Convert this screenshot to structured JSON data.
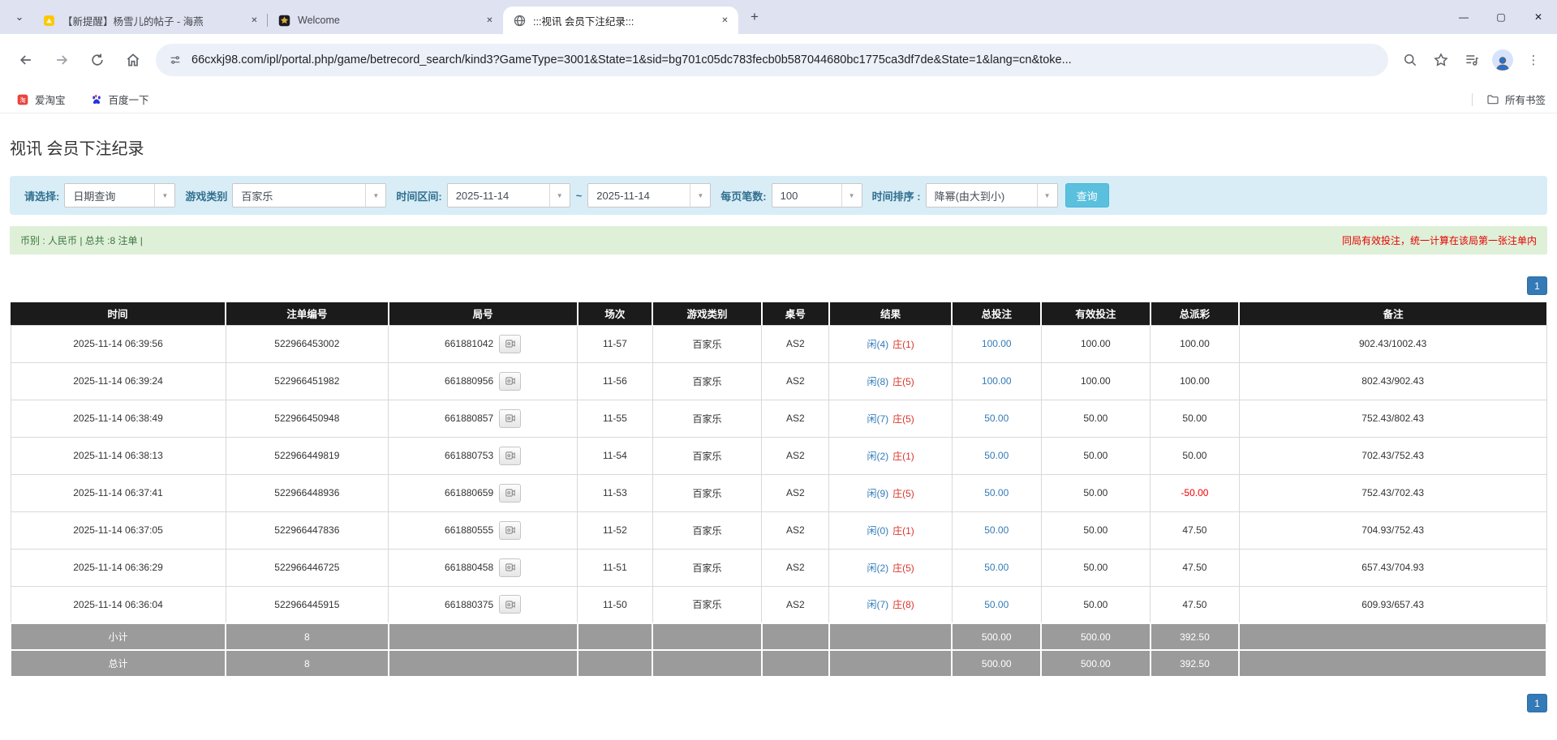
{
  "icons": {
    "tab_search": "⌄",
    "new_tab": "+",
    "minimize": "—",
    "maximize": "▢",
    "close": "✕",
    "tab_close": "✕",
    "dropdown": "▼",
    "more_vert": "⋮"
  },
  "browser": {
    "tabs": [
      {
        "title": "【新提醒】杨雪儿的帖子 - 海燕",
        "icon": "yellow-mail-icon",
        "active": false
      },
      {
        "title": "Welcome",
        "icon": "dark-emblem-icon",
        "active": false
      },
      {
        "title": ":::视讯 会员下注纪录:::",
        "icon": "globe-icon",
        "active": true
      }
    ],
    "url": "66cxkj98.com/ipl/portal.php/game/betrecord_search/kind3?GameType=3001&State=1&sid=bg701c05dc783fecb0b587044680bc1775ca3df7de&State=1&lang=cn&toke...",
    "bookmarks": [
      {
        "label": "爱淘宝",
        "icon": "taobao-icon"
      },
      {
        "label": "百度一下",
        "icon": "baidu-icon"
      }
    ],
    "bookmarks_right": {
      "label": "所有书签",
      "icon": "folder-icon"
    }
  },
  "page": {
    "title": "视讯 会员下注纪录",
    "filters": {
      "select_label": "请选择:",
      "select_value": "日期查询",
      "game_type_label": "游戏类别",
      "game_type_value": "百家乐",
      "date_range_label": "时间区间:",
      "date_from": "2025-11-14",
      "date_separator": "~",
      "date_to": "2025-11-14",
      "page_size_label": "每页笔数:",
      "page_size_value": "100",
      "sort_label": "时间排序 :",
      "sort_value": "降幂(由大到小)",
      "search_button": "查询"
    },
    "info_bar": {
      "left": "币别 : 人民币 | 总共 :8 注单 |",
      "right": "同局有效投注，统一计算在该局第一张注单内"
    },
    "pagination": {
      "page": "1"
    },
    "table": {
      "headers": [
        "时间",
        "注单编号",
        "局号",
        "场次",
        "游戏类别",
        "桌号",
        "结果",
        "总投注",
        "有效投注",
        "总派彩",
        "备注"
      ],
      "rows": [
        {
          "time": "2025-11-14 06:39:56",
          "bet_id": "522966453002",
          "round": "661881042",
          "session": "11-57",
          "game": "百家乐",
          "table_no": "AS2",
          "result_player": "闲(4)",
          "result_banker": "庄(1)",
          "total_bet": "100.00",
          "valid_bet": "100.00",
          "payout": "100.00",
          "note": "902.43/1002.43"
        },
        {
          "time": "2025-11-14 06:39:24",
          "bet_id": "522966451982",
          "round": "661880956",
          "session": "11-56",
          "game": "百家乐",
          "table_no": "AS2",
          "result_player": "闲(8)",
          "result_banker": "庄(5)",
          "total_bet": "100.00",
          "valid_bet": "100.00",
          "payout": "100.00",
          "note": "802.43/902.43"
        },
        {
          "time": "2025-11-14 06:38:49",
          "bet_id": "522966450948",
          "round": "661880857",
          "session": "11-55",
          "game": "百家乐",
          "table_no": "AS2",
          "result_player": "闲(7)",
          "result_banker": "庄(5)",
          "total_bet": "50.00",
          "valid_bet": "50.00",
          "payout": "50.00",
          "note": "752.43/802.43"
        },
        {
          "time": "2025-11-14 06:38:13",
          "bet_id": "522966449819",
          "round": "661880753",
          "session": "11-54",
          "game": "百家乐",
          "table_no": "AS2",
          "result_player": "闲(2)",
          "result_banker": "庄(1)",
          "total_bet": "50.00",
          "valid_bet": "50.00",
          "payout": "50.00",
          "note": "702.43/752.43"
        },
        {
          "time": "2025-11-14 06:37:41",
          "bet_id": "522966448936",
          "round": "661880659",
          "session": "11-53",
          "game": "百家乐",
          "table_no": "AS2",
          "result_player": "闲(9)",
          "result_banker": "庄(5)",
          "total_bet": "50.00",
          "valid_bet": "50.00",
          "payout": "-50.00",
          "note": "752.43/702.43"
        },
        {
          "time": "2025-11-14 06:37:05",
          "bet_id": "522966447836",
          "round": "661880555",
          "session": "11-52",
          "game": "百家乐",
          "table_no": "AS2",
          "result_player": "闲(0)",
          "result_banker": "庄(1)",
          "total_bet": "50.00",
          "valid_bet": "50.00",
          "payout": "47.50",
          "note": "704.93/752.43"
        },
        {
          "time": "2025-11-14 06:36:29",
          "bet_id": "522966446725",
          "round": "661880458",
          "session": "11-51",
          "game": "百家乐",
          "table_no": "AS2",
          "result_player": "闲(2)",
          "result_banker": "庄(5)",
          "total_bet": "50.00",
          "valid_bet": "50.00",
          "payout": "47.50",
          "note": "657.43/704.93"
        },
        {
          "time": "2025-11-14 06:36:04",
          "bet_id": "522966445915",
          "round": "661880375",
          "session": "11-50",
          "game": "百家乐",
          "table_no": "AS2",
          "result_player": "闲(7)",
          "result_banker": "庄(8)",
          "total_bet": "50.00",
          "valid_bet": "50.00",
          "payout": "47.50",
          "note": "609.93/657.43"
        }
      ],
      "summary": [
        {
          "label": "小计",
          "count": "8",
          "total_bet": "500.00",
          "valid_bet": "500.00",
          "payout": "392.50"
        },
        {
          "label": "总计",
          "count": "8",
          "total_bet": "500.00",
          "valid_bet": "500.00",
          "payout": "392.50"
        }
      ]
    },
    "colors": {
      "accent_blue": "#337ab7",
      "banker_red": "#d9342b",
      "negative_red": "#f00000",
      "filter_bg": "#d9edf7",
      "info_bg": "#dff0d8",
      "header_bg": "#1b1b1b",
      "summary_bg": "#9b9b9b",
      "search_btn": "#5bc0de"
    }
  }
}
